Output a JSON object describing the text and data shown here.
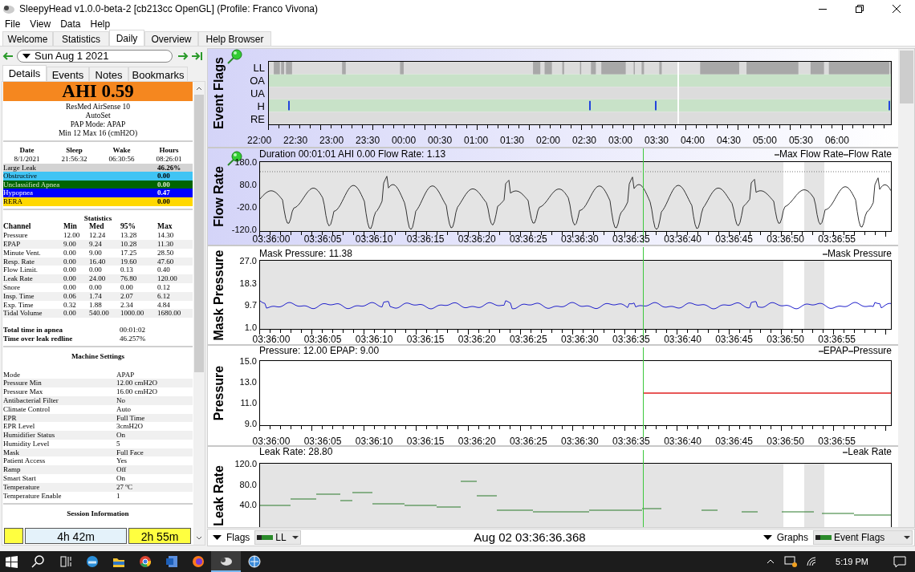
{
  "window": {
    "title": "SleepyHead v1.0.0-beta-2 [cb213cc OpenGL] (Profile: Franco Vivona)"
  },
  "menu": [
    "File",
    "View",
    "Data",
    "Help"
  ],
  "tabs": [
    {
      "label": "Welcome",
      "selected": false
    },
    {
      "label": "Statistics",
      "selected": false
    },
    {
      "label": "Daily",
      "selected": true
    },
    {
      "label": "Overview",
      "selected": false
    },
    {
      "label": "Help Browser",
      "selected": false
    }
  ],
  "left": {
    "date": "Sun Aug 1 2021",
    "subtabs": [
      {
        "label": "Details",
        "selected": true
      },
      {
        "label": "Events",
        "selected": false
      },
      {
        "label": "Notes",
        "selected": false
      },
      {
        "label": "Bookmarks",
        "selected": false
      }
    ],
    "ahi": "AHI 0.59",
    "machine": [
      "ResMed AirSense 10",
      "AutoSet",
      "PAP Mode: APAP",
      "Min 12 Max 16 (cmH2O)"
    ],
    "summary": {
      "columns": [
        "Date",
        "Sleep",
        "Wake",
        "Hours"
      ],
      "values": [
        "8/1/2021",
        "21:56:32",
        "06:30:56",
        "08:26:01"
      ]
    },
    "indices": [
      {
        "label": "Large Leak",
        "value": "46.26%",
        "color": "#d3d3d3"
      },
      {
        "label": "Obstructive",
        "value": "0.00",
        "color": "#40c4f4"
      },
      {
        "label": "Unclassified Apnea",
        "value": "0.00",
        "color": "#006400"
      },
      {
        "label": "Hypopnea",
        "value": "0.47",
        "color": "#0000ff"
      },
      {
        "label": "RERA",
        "value": "0.00",
        "color": "#ffd800"
      }
    ],
    "statistics": {
      "title": "Statistics",
      "columns": [
        "Channel",
        "Min",
        "Med",
        "95%",
        "Max"
      ],
      "rows": [
        [
          "Pressure",
          "12.00",
          "12.24",
          "13.28",
          "14.30"
        ],
        [
          "EPAP",
          "9.00",
          "9.24",
          "10.28",
          "11.30"
        ],
        [
          "Minute Vent.",
          "0.00",
          "9.00",
          "17.25",
          "28.50"
        ],
        [
          "Resp. Rate",
          "0.00",
          "16.40",
          "19.60",
          "47.60"
        ],
        [
          "Flow Limit.",
          "0.00",
          "0.00",
          "0.13",
          "0.40"
        ],
        [
          "Leak Rate",
          "0.00",
          "24.00",
          "76.80",
          "120.00"
        ],
        [
          "Snore",
          "0.00",
          "0.00",
          "0.00",
          "0.12"
        ],
        [
          "Insp. Time",
          "0.06",
          "1.74",
          "2.07",
          "6.12"
        ],
        [
          "Exp. Time",
          "0.32",
          "1.88",
          "2.34",
          "4.84"
        ],
        [
          "Tidal Volume",
          "0.00",
          "540.00",
          "1000.00",
          "1680.00"
        ]
      ]
    },
    "totals": [
      {
        "label": "Total time in apnea",
        "value": "00:01:02"
      },
      {
        "label": "Time over leak redline",
        "value": "46.257%"
      }
    ],
    "settings": {
      "title": "Machine Settings",
      "rows": [
        [
          "Mode",
          "APAP"
        ],
        [
          "Pressure Min",
          "12.00 cmH2O"
        ],
        [
          "Pressure Max",
          "16.00 cmH2O"
        ],
        [
          "Antibacterial Filter",
          "No"
        ],
        [
          "Climate Control",
          "Auto"
        ],
        [
          "EPR",
          "Full Time"
        ],
        [
          "EPR Level",
          "3cmH2O"
        ],
        [
          "Humidifier Status",
          "On"
        ],
        [
          "Humidity Level",
          "5"
        ],
        [
          "Mask",
          "Full Face"
        ],
        [
          "Patient Access",
          "Yes"
        ],
        [
          "Ramp",
          "Off"
        ],
        [
          "Smart Start",
          "On"
        ],
        [
          "Temperature",
          "27 ºC"
        ],
        [
          "Temperature Enable",
          "1"
        ]
      ]
    },
    "session": {
      "title": "Session Information",
      "segments": [
        {
          "color": "#ffff40"
        },
        {
          "label": "4h 42m",
          "color": "#e4f2fa"
        },
        {
          "label": "2h 55m",
          "color": "#ffff40"
        }
      ]
    }
  },
  "graphs": [
    {
      "kind": "flags",
      "title": "Event Flags",
      "rows": [
        "LL",
        "OA",
        "UA",
        "H",
        "RE"
      ],
      "xticks": [
        "22:00",
        "22:30",
        "23:00",
        "23:30",
        "00:00",
        "00:30",
        "01:00",
        "01:30",
        "02:00",
        "02:30",
        "03:00",
        "03:30",
        "04:00",
        "04:30",
        "05:00",
        "05:30",
        "06:00"
      ]
    },
    {
      "kind": "flow",
      "title": "Flow Rate",
      "header": "Duration 00:01:01 AHI 0.00 Flow Rate: 1.13",
      "legend": [
        "Max Flow Rate",
        "Flow Rate"
      ],
      "yticks": [
        "180.0",
        "80.0",
        "-20.0",
        "-120.0"
      ],
      "xticks": [
        "03:36:00",
        "03:36:05",
        "03:36:10",
        "03:36:15",
        "03:36:20",
        "03:36:25",
        "03:36:30",
        "03:36:35",
        "03:36:40",
        "03:36:45",
        "03:36:50",
        "03:36:55"
      ]
    },
    {
      "kind": "mask",
      "title": "Mask Pressure",
      "header": "Mask Pressure: 11.38",
      "legend": [
        "Mask Pressure"
      ],
      "yticks": [
        "27.0",
        "18.3",
        "9.7",
        "1.0"
      ],
      "xticks": [
        "03:36:00",
        "03:36:05",
        "03:36:10",
        "03:36:15",
        "03:36:20",
        "03:36:25",
        "03:36:30",
        "03:36:35",
        "03:36:40",
        "03:36:45",
        "03:36:50",
        "03:36:55"
      ]
    },
    {
      "kind": "pressure",
      "title": "Pressure",
      "header": "Pressure: 12.00 EPAP: 9.00",
      "legend": [
        "EPAP",
        "Pressure"
      ],
      "yticks": [
        "15.0",
        "13.0",
        "11.0",
        "9.0"
      ],
      "xticks": [
        "03:36:00",
        "03:36:05",
        "03:36:10",
        "03:36:15",
        "03:36:20",
        "03:36:25",
        "03:36:30",
        "03:36:35",
        "03:36:40",
        "03:36:45",
        "03:36:50",
        "03:36:55"
      ]
    },
    {
      "kind": "leak",
      "title": "Leak Rate",
      "header": "Leak Rate: 28.80",
      "legend": [
        "Leak Rate"
      ],
      "yticks": [
        "120.0",
        "80.0",
        "40.0"
      ]
    }
  ],
  "bottom": {
    "flags": "Flags",
    "flag_select": "LL",
    "time": "Aug 02 03:36:36.368",
    "graphs": "Graphs",
    "graph_select": "Event Flags"
  },
  "taskbar": {
    "time": "5:19 PM"
  }
}
